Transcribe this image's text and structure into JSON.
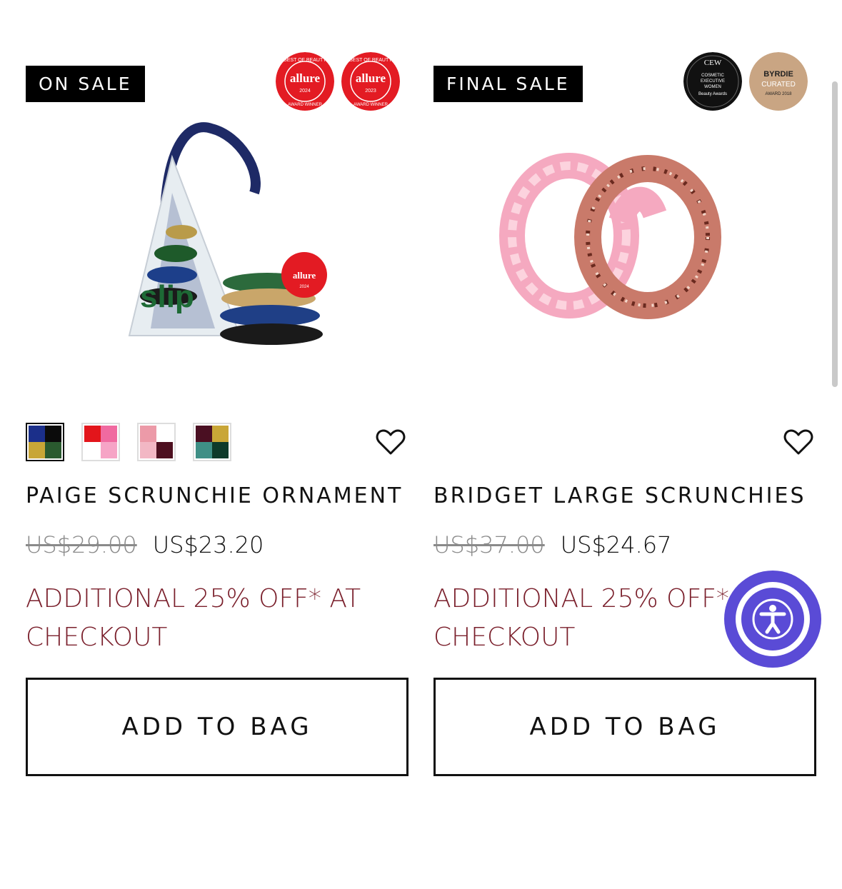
{
  "products": [
    {
      "tag": "ON SALE",
      "badges": [
        {
          "brand": "allure",
          "ring": "BEST OF BEAUTY",
          "sub": "AWARD WINNER",
          "year": "2024",
          "color": "#e31b23"
        },
        {
          "brand": "allure",
          "ring": "BEST OF BEAUTY",
          "sub": "AWARD WINNER",
          "year": "2023",
          "color": "#e31b23"
        }
      ],
      "image_icon": "scrunchie-ornament-image",
      "image_text": {
        "brand": "slip",
        "badge_brand": "allure",
        "badge_year": "2024"
      },
      "swatches": [
        {
          "colors": [
            "#1b2f8a",
            "#0b0b0b",
            "#c8a637",
            "#2a5a2f"
          ],
          "selected": true
        },
        {
          "colors": [
            "#e3151b",
            "#f06aa0",
            "#ffffff",
            "#f6a4c6"
          ],
          "selected": false
        },
        {
          "colors": [
            "#ec9aa8",
            "#ffffff",
            "#f2b7c4",
            "#4d0f1f"
          ],
          "selected": false
        },
        {
          "colors": [
            "#4a0f22",
            "#c9a637",
            "#3f8f86",
            "#0e3a2a"
          ],
          "selected": false
        }
      ],
      "title": "PAIGE SCRUNCHIE ORNAMENT",
      "old_price": "US$29.00",
      "new_price": "US$23.20",
      "promo": "ADDITIONAL 25% OFF* AT CHECKOUT",
      "button": "ADD TO BAG"
    },
    {
      "tag": "FINAL SALE",
      "badges": [
        {
          "brand": "CEW",
          "lines": [
            "COSMETIC",
            "EXECUTIVE",
            "WOMEN",
            "Beauty Awards"
          ],
          "color": "#111111"
        },
        {
          "brand": "BYRDIE",
          "lines": [
            "CURATED",
            "AWARD 2018"
          ],
          "color": "#c9a583"
        }
      ],
      "image_icon": "large-scrunchies-image",
      "swatches": [],
      "title": "BRIDGET LARGE SCRUNCHIES",
      "old_price": "US$37.00",
      "new_price": "US$24.67",
      "promo": "ADDITIONAL 25% OFF* AT CHECKOUT",
      "button": "ADD TO BAG"
    }
  ],
  "accessibility_button": {
    "icon": "accessibility-icon",
    "color": "#5a4bd6"
  },
  "wishlist_icon": "heart-outline-icon"
}
